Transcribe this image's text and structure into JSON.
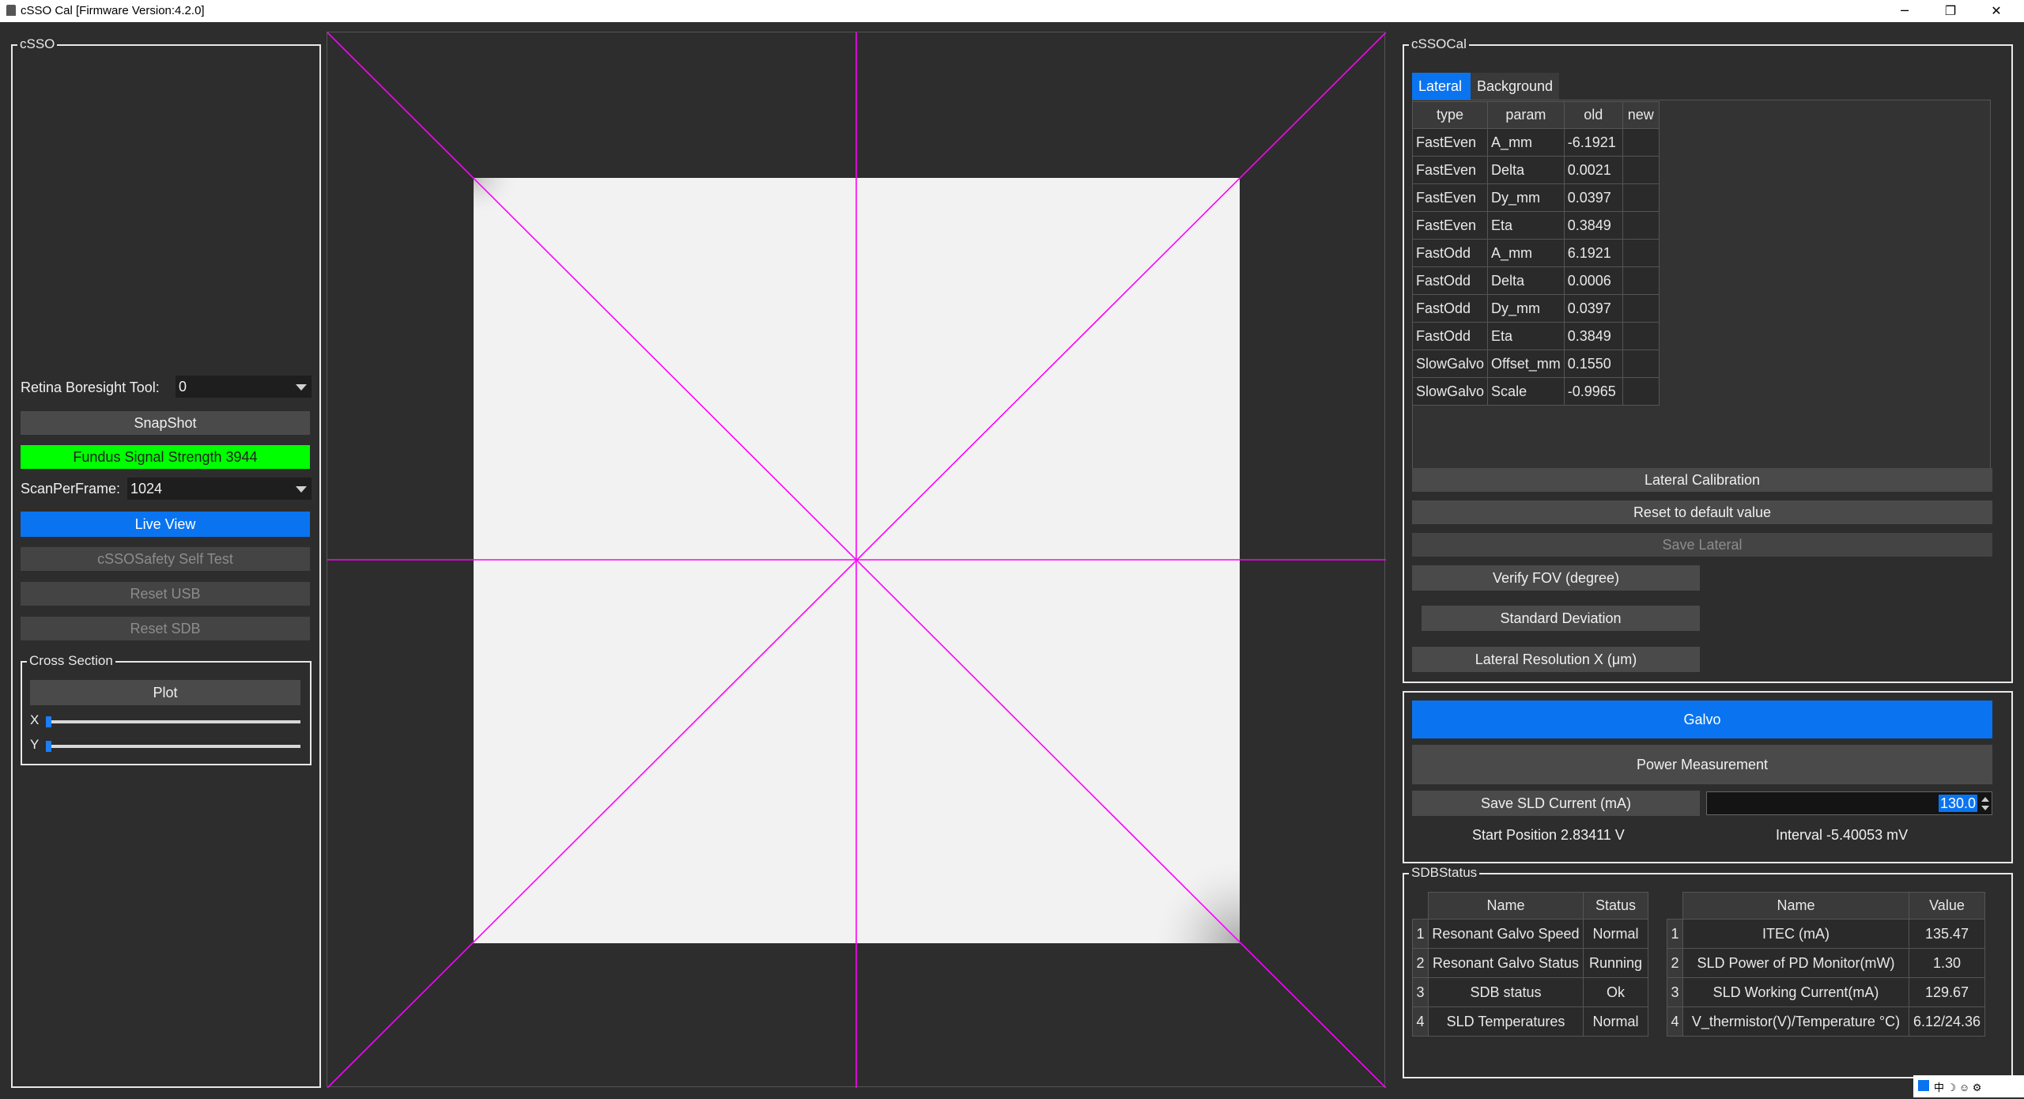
{
  "window": {
    "title": "cSSO Cal [Firmware Version:4.2.0]",
    "minimize_icon": "─",
    "restore_icon": "❐",
    "close_icon": "✕"
  },
  "left_panel": {
    "group_title": "cSSO",
    "boresight_label": "Retina Boresight Tool:",
    "boresight_value": "0",
    "snapshot_label": "SnapShot",
    "signal_strength_label": "Fundus Signal Strength 3944",
    "signal_color": "#00ff00",
    "scan_per_frame_label": "ScanPerFrame:",
    "scan_per_frame_value": "1024",
    "live_view_label": "Live View",
    "self_test_label": "cSSOSafety Self Test",
    "reset_usb_label": "Reset USB",
    "reset_sdb_label": "Reset SDB",
    "cross_section": {
      "title": "Cross Section",
      "plot_label": "Plot",
      "x_label": "X",
      "y_label": "Y",
      "x_value": 0,
      "y_value": 0
    }
  },
  "viewer": {
    "crosshair_color": "#ff00ff",
    "image_color": "#f2f2f2"
  },
  "right_panel": {
    "group_title": "cSSOCal",
    "tabs": [
      {
        "label": "Lateral",
        "active": true
      },
      {
        "label": "Background",
        "active": false
      }
    ],
    "table_headers": [
      "type",
      "param",
      "old",
      "new"
    ],
    "table_rows": [
      [
        "FastEven",
        "A_mm",
        "-6.1921",
        ""
      ],
      [
        "FastEven",
        "Delta",
        "0.0021",
        ""
      ],
      [
        "FastEven",
        "Dy_mm",
        "0.0397",
        ""
      ],
      [
        "FastEven",
        "Eta",
        "0.3849",
        ""
      ],
      [
        "FastOdd",
        "A_mm",
        "6.1921",
        ""
      ],
      [
        "FastOdd",
        "Delta",
        "0.0006",
        ""
      ],
      [
        "FastOdd",
        "Dy_mm",
        "0.0397",
        ""
      ],
      [
        "FastOdd",
        "Eta",
        "0.3849",
        ""
      ],
      [
        "SlowGalvo",
        "Offset_mm",
        "0.1550",
        ""
      ],
      [
        "SlowGalvo",
        "Scale",
        "-0.9965",
        ""
      ]
    ],
    "lateral_calibration_label": "Lateral Calibration",
    "reset_default_label": "Reset to default value",
    "save_lateral_label": "Save Lateral",
    "verify_fov_label": "Verify FOV (degree)",
    "std_dev_label": "Standard Deviation",
    "lateral_resolution_label": "Lateral Resolution X (μm)",
    "galvo_label": "Galvo",
    "power_measurement_label": "Power Measurement",
    "save_sld_label": "Save SLD Current (mA)",
    "sld_current_value": "130.0",
    "start_position_label": "Start Position 2.83411 V",
    "interval_label": "Interval -5.40053 mV",
    "accent_color": "#0a74f0"
  },
  "sdb_status": {
    "group_title": "SDBStatus",
    "left_headers": [
      "Name",
      "Status"
    ],
    "left_rows": [
      [
        "1",
        "Resonant Galvo Speed",
        "Normal"
      ],
      [
        "2",
        "Resonant Galvo Status",
        "Running"
      ],
      [
        "3",
        "SDB status",
        "Ok"
      ],
      [
        "4",
        "SLD Temperatures",
        "Normal"
      ]
    ],
    "right_headers": [
      "Name",
      "Value"
    ],
    "right_rows": [
      [
        "1",
        "ITEC (mA)",
        "135.47"
      ],
      [
        "2",
        "SLD Power of PD Monitor(mW)",
        "1.30"
      ],
      [
        "3",
        "SLD Working Current(mA)",
        "129.67"
      ],
      [
        "4",
        "V_thermistor(V)/Temperature °C)",
        "6.12/24.36"
      ]
    ]
  },
  "tray": {
    "text": "中 ☽ ☺ ⚙"
  }
}
